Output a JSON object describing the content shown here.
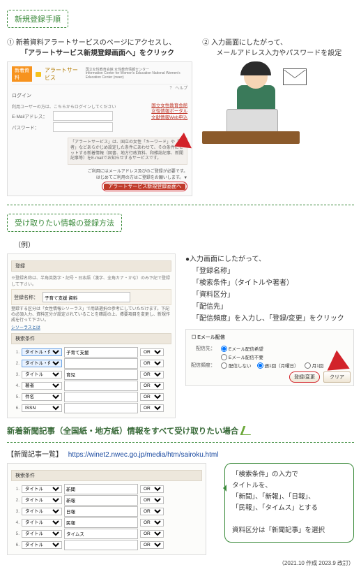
{
  "headers": {
    "h1": "新規登録手順",
    "h2": "受け取りたい情報の登録方法",
    "h3": "新着新聞記事（全国紙・地方紙）情報をすべて受け取りたい場合"
  },
  "step1": {
    "num": "①",
    "l1": "新着資料アラートサービスのページにアクセスし、",
    "l2": "「アラートサービス新規登録画面へ」をクリック"
  },
  "step2": {
    "num": "②",
    "l1": "入力画面にしたがって、",
    "l2": "メールアドレス入力やパスワードを設定"
  },
  "panelA": {
    "brand1": "新着資料",
    "brand2": "アラートサービス",
    "brand3": "国立女性教育会館 女性教育情報センター",
    "brand3sub": "Information Center for Women's Education National Women's Education Center (nwec)",
    "faqlabel": "？ ヘルプ",
    "loginHead": "ログイン",
    "loginNote": "利用ユーザーの方は、こちらからログインしてください",
    "emailLabel": "E-Mailアドレス：",
    "pwLabel": "パスワード：",
    "links": [
      "国立女性教育会館",
      "女性情報ポータル",
      "文献情報Web申込"
    ],
    "note": "「アラートサービス」は、国立の女性「キーワード」や「著者」などあらかじめ設定した条件にあわせて、その条件にヒットする新着情報（図書、地方行政資料、和雑誌記事、新聞記事等）をE-mailでお知らせするサービスです。",
    "foot1": "ご利用にはメールアドレス及びのご登録が必要です。",
    "foot2": "はじめてご利用の方はご登録をお願いします。▼",
    "redBtn": "アラートサービス新規登録画面へ"
  },
  "example_label": "（例）",
  "panelB": {
    "top": "登録",
    "desc": "※登録名称は、半角英数字・記号・日本語（漢字、全角カナ・かな）のみ下記で登録して下さい。",
    "reg_label": "登録名称：",
    "reg_val": "子育て支援 資料",
    "checks": "登録する区分は「女性情報シソーラス」で用語選択の参考にしていただけます。下記の必須入力、資料区分が設定されていることを確認の上、挿要項目を変更し、新規作成を行って下さい。",
    "link": "シソーラスとは",
    "secHead": "検索条件",
    "rows": [
      {
        "n": "1.",
        "f": "タイトル・件名",
        "v": "子育て支援",
        "op": "OR"
      },
      {
        "n": "2.",
        "f": "タイトル・件名",
        "v": "",
        "op": "OR"
      },
      {
        "n": "3.",
        "f": "タイトル",
        "v": "育児",
        "op": "OR"
      },
      {
        "n": "4.",
        "f": "著者",
        "v": "",
        "op": "OR"
      },
      {
        "n": "5.",
        "f": "件名",
        "v": "",
        "op": "OR"
      },
      {
        "n": "6.",
        "f": "ISSN",
        "v": "",
        "op": "OR"
      }
    ]
  },
  "bullets": {
    "lead": "●入力画面にしたがって、",
    "items": [
      "「登録名称」",
      "「検索条件」（タイトルや著者）",
      "「資料区分」",
      "「配信先」",
      "「配信頻度」を入力し、「登録/変更」をクリック"
    ]
  },
  "panelC": {
    "head": "Eメール配信",
    "r1_label": "配信先：",
    "r1a": "Eメール配信希望",
    "r1b": "Eメール配信不要",
    "r2_label": "配信頻度：",
    "r2a": "配信しない",
    "r2b": "週1回（月曜日）",
    "r2c": "月1回",
    "btn1": "登録/変更",
    "btn2": "クリア"
  },
  "newsLink": {
    "label": "【新聞記事一覧】",
    "url": "https://winet2.nwec.go.jp/media/htm/sairoku.html"
  },
  "panelD": {
    "secHead": "検索条件",
    "rows": [
      {
        "n": "1.",
        "f": "タイトル",
        "v": "新聞",
        "op": "OR"
      },
      {
        "n": "2.",
        "f": "タイトル",
        "v": "新報",
        "op": "OR"
      },
      {
        "n": "3.",
        "f": "タイトル",
        "v": "日報",
        "op": "OR"
      },
      {
        "n": "4.",
        "f": "タイトル",
        "v": "民報",
        "op": "OR"
      },
      {
        "n": "5.",
        "f": "タイトル",
        "v": "タイムス",
        "op": "OR"
      },
      {
        "n": "6.",
        "f": "タイトル",
        "v": "",
        "op": "OR"
      }
    ]
  },
  "callout": {
    "l1": "「検索条件」の入力で",
    "l2": "タイトルを、",
    "l3": "「新聞」、「新報」、「日報」、",
    "l4": "「民報」、「タイムス」とする",
    "l5": "資料区分は「新聞記事」を選択"
  },
  "footer": "（2021.10 作成 2023.9 改訂）"
}
